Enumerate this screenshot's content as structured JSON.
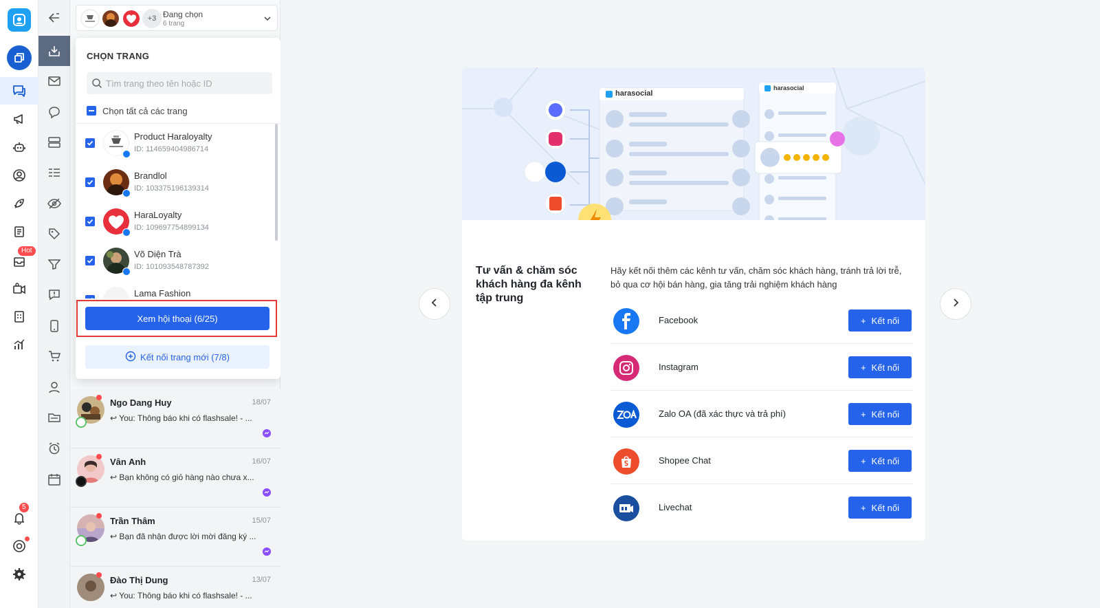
{
  "page_selector": {
    "avatar_count": "+3",
    "title": "Đang chọn",
    "subtitle": "6 trang"
  },
  "dropdown": {
    "title": "CHỌN TRANG",
    "search_placeholder": "Tìm trang theo tên hoặc ID",
    "select_all": "Chọn tất cả các trang",
    "pages": [
      {
        "name": "Product Haraloyalty",
        "id": "ID: 114659404986714",
        "checked": true
      },
      {
        "name": "Brandlol",
        "id": "ID: 103375196139314",
        "checked": true
      },
      {
        "name": "HaraLoyalty",
        "id": "ID: 109697754899134",
        "checked": true
      },
      {
        "name": "Võ Diện Trà",
        "id": "ID: 101093548787392",
        "checked": true
      },
      {
        "name": "Lama Fashion",
        "id": "",
        "checked": true
      }
    ],
    "view_button": "Xem hội thoại (6/25)",
    "connect_button": "Kết nối trang mới (7/8)"
  },
  "conversations": [
    {
      "name": "Ngo Dang Huy",
      "date": "18/07",
      "message": "You: Thông báo khi có flashsale! - ..."
    },
    {
      "name": "Vân Anh",
      "date": "16/07",
      "message": "Bạn không có giỏ hàng nào chưa x..."
    },
    {
      "name": "Trần Thâm",
      "date": "15/07",
      "message": "Bạn đã nhận được lời mời đăng ký ..."
    },
    {
      "name": "Đào Thị Dung",
      "date": "13/07",
      "message": "You: Thông báo khi có flashsale! - ..."
    }
  ],
  "rail": {
    "hot_badge": "Hot",
    "notification_count": "5"
  },
  "hero": {
    "brand": "harasocial",
    "brand_small": "harasocial"
  },
  "card": {
    "title": "Tư vấn & chăm sóc khách hàng đa kênh tập trung",
    "description": "Hãy kết nối thêm các kênh tư vấn, chăm sóc khách hàng, tránh trả lời trễ, bỏ qua cơ hội bán hàng, gia tăng trải nghiệm khách hàng",
    "channels": [
      {
        "name": "Facebook",
        "button": "Kết nối",
        "icon": "facebook-icon",
        "color": "#1877f2"
      },
      {
        "name": "Instagram",
        "button": "Kết nối",
        "icon": "instagram-icon",
        "color": "#d62976"
      },
      {
        "name": "Zalo OA (đã xác thực và trả phí)",
        "button": "Kết nối",
        "icon": "zalo-oa-icon",
        "color": "#0a5ad4"
      },
      {
        "name": "Shopee Chat",
        "button": "Kết nối",
        "icon": "shopee-icon",
        "color": "#ee4d2d"
      },
      {
        "name": "Livechat",
        "button": "Kết nối",
        "icon": "livechat-icon",
        "color": "#1a4e9e"
      }
    ]
  },
  "colors": {
    "accent": "#2563eb",
    "highlight": "#e53935"
  }
}
